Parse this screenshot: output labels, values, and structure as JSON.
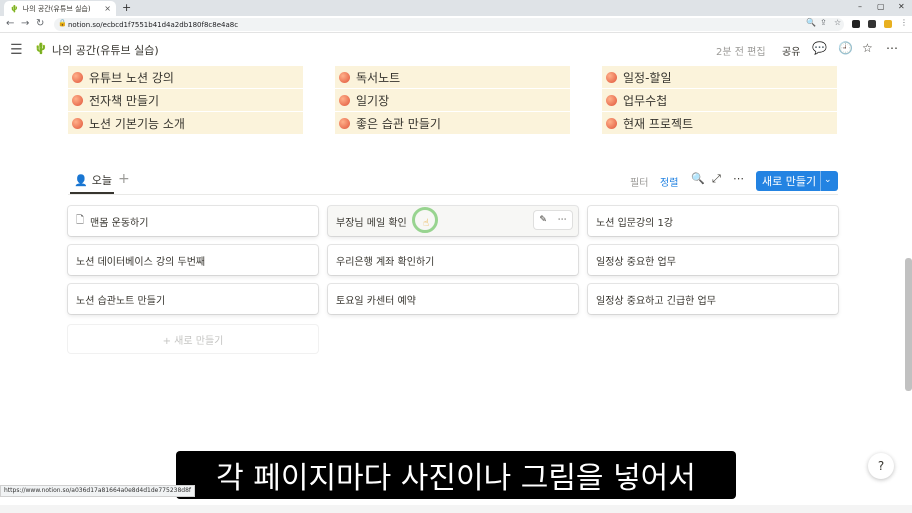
{
  "browser": {
    "tab_title": "나의 공간(유튜브 실습)",
    "tab_close": "×",
    "new_tab": "+",
    "url": "notion.so/ecbcd1f7551b41d4a2db180f8c8e4a8c",
    "window_controls": [
      "–",
      "▢",
      "✕"
    ]
  },
  "topbar": {
    "page_title": "나의 공간(유튜브 실습)",
    "edited": "2분 전 편집",
    "share": "공유"
  },
  "links": {
    "col1": [
      "유튜브 노션 강의",
      "전자책 만들기",
      "노션 기본기능 소개"
    ],
    "col2": [
      "독서노트",
      "일기장",
      "좋은 습관 만들기"
    ],
    "col3": [
      "일정-할일",
      "업무수첩",
      "현재 프로젝트"
    ]
  },
  "board": {
    "view_tab": "오늘",
    "filter": "필터",
    "sort": "정렬",
    "new_button": "새로 만들기",
    "add_card": "+ 새로 만들기",
    "col1": [
      "맨몸 운동하기",
      "노션 데이터베이스 강의 두번째",
      "노션 습관노트 만들기"
    ],
    "col2": [
      "부장님 메일 확인",
      "우리은행 계좌 확인하기",
      "토요일 카센터 예약"
    ],
    "col3": [
      "노션 입문강의 1강",
      "일정상 중요한 업무",
      "일정상 중요하고 긴급한 업무"
    ]
  },
  "subtitle": "각 페이지마다 사진이나 그림을 넣어서",
  "status_url": "https://www.notion.so/a036d17a81664a0e8d4d1de775238d8f",
  "help": "?",
  "colors": {
    "accent": "#2383e2",
    "link_bg": "#fbf3db",
    "text": "#37352f"
  }
}
